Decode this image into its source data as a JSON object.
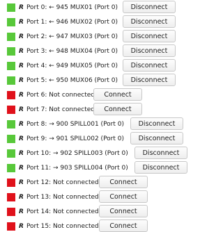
{
  "colors": {
    "connected": "#58c83a",
    "disconnected": "#e0111b"
  },
  "ports": [
    {
      "prefix": "R",
      "label": "Port 0: ← 945 MUX01 (Port 0)",
      "status": "connected",
      "button": "Disconnect"
    },
    {
      "prefix": "R",
      "label": "Port 1: ← 946 MUX02 (Port 0)",
      "status": "connected",
      "button": "Disconnect"
    },
    {
      "prefix": "R",
      "label": "Port 2: ← 947 MUX03 (Port 0)",
      "status": "connected",
      "button": "Disconnect"
    },
    {
      "prefix": "R",
      "label": "Port 3: ← 948 MUX04 (Port 0)",
      "status": "connected",
      "button": "Disconnect"
    },
    {
      "prefix": "R",
      "label": "Port 4: ← 949 MUX05 (Port 0)",
      "status": "connected",
      "button": "Disconnect"
    },
    {
      "prefix": "R",
      "label": "Port 5: ← 950 MUX06 (Port 0)",
      "status": "connected",
      "button": "Disconnect"
    },
    {
      "prefix": "R",
      "label": "Port 6: Not connected.",
      "status": "disconnected",
      "button": "Connect"
    },
    {
      "prefix": "R",
      "label": "Port 7: Not connected.",
      "status": "disconnected",
      "button": "Connect"
    },
    {
      "prefix": "R",
      "label": "Port 8: → 900 SPILL001 (Port 0)",
      "status": "connected",
      "button": "Disconnect"
    },
    {
      "prefix": "R",
      "label": "Port 9: → 901 SPILL002 (Port 0)",
      "status": "connected",
      "button": "Disconnect"
    },
    {
      "prefix": "R",
      "label": "Port 10: → 902 SPILL003 (Port 0)",
      "status": "connected",
      "button": "Disconnect"
    },
    {
      "prefix": "R",
      "label": "Port 11: → 903 SPILL004 (Port 0)",
      "status": "connected",
      "button": "Disconnect"
    },
    {
      "prefix": "R",
      "label": "Port 12: Not connected.",
      "status": "disconnected",
      "button": "Connect"
    },
    {
      "prefix": "R",
      "label": "Port 13: Not connected.",
      "status": "disconnected",
      "button": "Connect"
    },
    {
      "prefix": "R",
      "label": "Port 14: Not connected.",
      "status": "disconnected",
      "button": "Connect"
    },
    {
      "prefix": "R",
      "label": "Port 15: Not connected.",
      "status": "disconnected",
      "button": "Connect"
    }
  ]
}
